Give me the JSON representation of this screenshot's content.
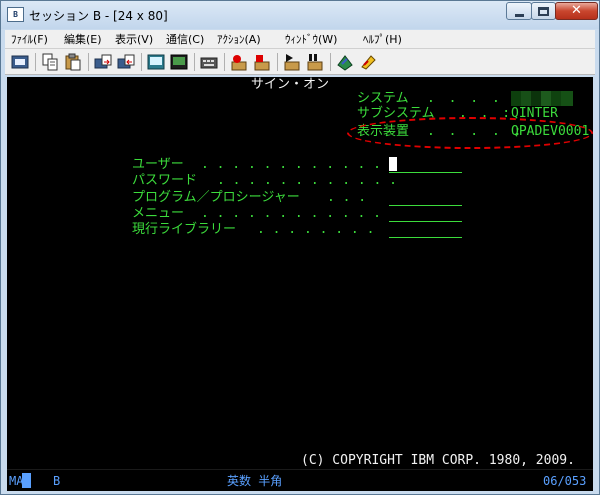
{
  "window": {
    "title": "セッション B - [24 x 80]",
    "icon_label": "B"
  },
  "menu": [
    {
      "label": "ﾌｧｲﾙ(F)"
    },
    {
      "label": "編集(E)"
    },
    {
      "label": "表示(V)"
    },
    {
      "label": "通信(C)"
    },
    {
      "label": "ｱｸｼｮﾝ(A)"
    },
    {
      "label": "ｳｨﾝﾄﾞｳ(W)"
    },
    {
      "label": "ﾍﾙﾌﾟ(H)"
    }
  ],
  "toolbar": {
    "icons": [
      "print-screen-icon",
      "copy-icon",
      "paste-icon",
      "send-file-icon",
      "receive-file-icon",
      "display-keypad-icon",
      "macro-icon",
      "record-macro-icon",
      "stop-macro-icon",
      "play-macro-icon",
      "map-icon",
      "customize-icon"
    ]
  },
  "terminal": {
    "heading": "サイン・オン",
    "system_info": [
      {
        "label": "システム",
        "dots": ". . . . :",
        "value": ""
      },
      {
        "label": "サブシステム",
        "dots": ". . :",
        "value": "QINTER"
      },
      {
        "label": "表示装置",
        "dots": ". . . . :",
        "value": "QPADEV0001"
      }
    ],
    "fields": [
      {
        "label": "ユーザー",
        "dots": ". . . . . . . . . . . . ."
      },
      {
        "label": "パスワード",
        "dots": ". . . . . . . . . . . ."
      },
      {
        "label": "プログラム／プロシージャー",
        "dots": ". . ."
      },
      {
        "label": "メニュー",
        "dots": ". . . . . . . . . . . ."
      },
      {
        "label": "現行ライブラリー",
        "dots": ". . . . . . . ."
      }
    ],
    "copyright": "(C) COPYRIGHT IBM CORP. 1980, 2009.",
    "colors": {
      "field_text": "#3cdc3c",
      "heading": "#f2f2f2",
      "highlight": "#e00000"
    }
  },
  "status": {
    "left_code": "MA",
    "session": "B",
    "input_mode": "英数 半角",
    "cursor_position": "06/053",
    "color": "#5aa0ff"
  }
}
